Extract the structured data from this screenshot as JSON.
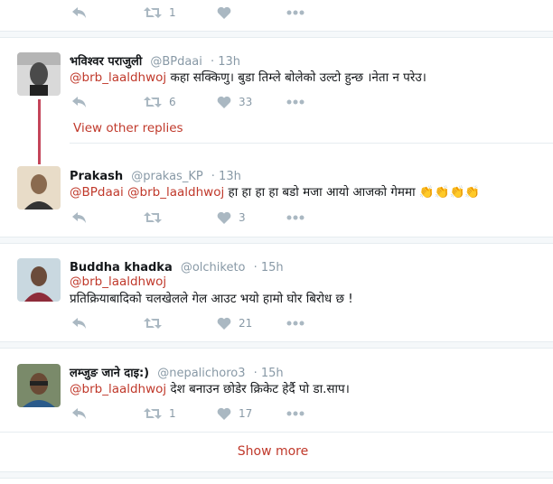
{
  "top_actions": {
    "retweets": "1"
  },
  "tweets": [
    {
      "name": "भविश्वर पराजुली",
      "handle": "@BPdaai",
      "time": "· 13h",
      "mention": "@brb_laaldhwoj",
      "text": " कहा सक्किणु। बुडा तिम्ले बोलेको उल्टो हुन्छ ।नेता न परेउ।",
      "retweets": "6",
      "likes": "33"
    },
    {
      "name": "Prakash",
      "handle": "@prakas_KP",
      "time": "· 13h",
      "mention": "@BPdaai @brb_laaldhwoj",
      "text": " हा हा हा हा बडो  मजा आयो आजको गेममा 👏👏👏👏",
      "retweets": "",
      "likes": "3"
    },
    {
      "name": "Buddha khadka",
      "handle": "@olchiketo",
      "time": "· 15h",
      "mention": "@brb_laaldhwoj",
      "text": "प्रतिक्रियाबादिको चलखेलले गेल आउट भयो हामो घोर बिरोध छ !",
      "retweets": "",
      "likes": "21"
    },
    {
      "name": "लम्जुङ जाने दाइ:)",
      "handle": "@nepalichoro3",
      "time": "· 15h",
      "mention": "@brb_laaldhwoj",
      "text": " देश बनाउन छोडेर क्रिकेट हेर्दै पो डा.साप।",
      "retweets": "1",
      "likes": "17"
    }
  ],
  "view_other_replies": "View other replies",
  "show_more": "Show more",
  "colors": {
    "link": "#c0392b",
    "thread_line": "#c4455a",
    "icon": "#aab8c2"
  }
}
